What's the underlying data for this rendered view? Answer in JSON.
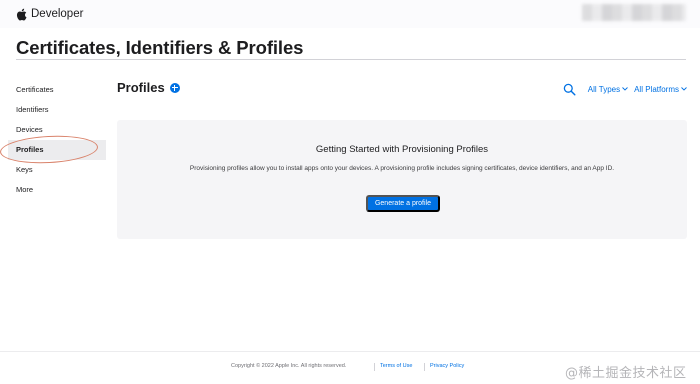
{
  "header": {
    "brand": "Developer",
    "page_title": "Certificates, Identifiers & Profiles"
  },
  "sidebar": {
    "items": [
      {
        "label": "Certificates"
      },
      {
        "label": "Identifiers"
      },
      {
        "label": "Devices"
      },
      {
        "label": "Profiles",
        "selected": true
      },
      {
        "label": "Keys"
      },
      {
        "label": "More"
      }
    ]
  },
  "main": {
    "section_title": "Profiles",
    "filters": {
      "types": "All Types",
      "platforms": "All Platforms"
    },
    "empty_state": {
      "title": "Getting Started with Provisioning Profiles",
      "description": "Provisioning profiles allow you to install apps onto your devices. A provisioning profile includes signing certificates, device identifiers, and an App ID.",
      "button": "Generate a profile"
    }
  },
  "footer": {
    "copyright": "Copyright © 2022 Apple Inc. All rights reserved.",
    "terms": "Terms of Use",
    "privacy": "Privacy Policy"
  },
  "watermark": "@稀土掘金技术社区",
  "icons": {
    "brand": "apple-logo-icon",
    "add": "plus-circle-icon",
    "search": "search-icon",
    "dropdown": "chevron-down-icon"
  },
  "colors": {
    "accent": "#0071e3",
    "text": "#1d1d1f",
    "card_bg": "#f5f5f7",
    "selected_bg": "#ececee",
    "annotation": "#d9826a"
  }
}
